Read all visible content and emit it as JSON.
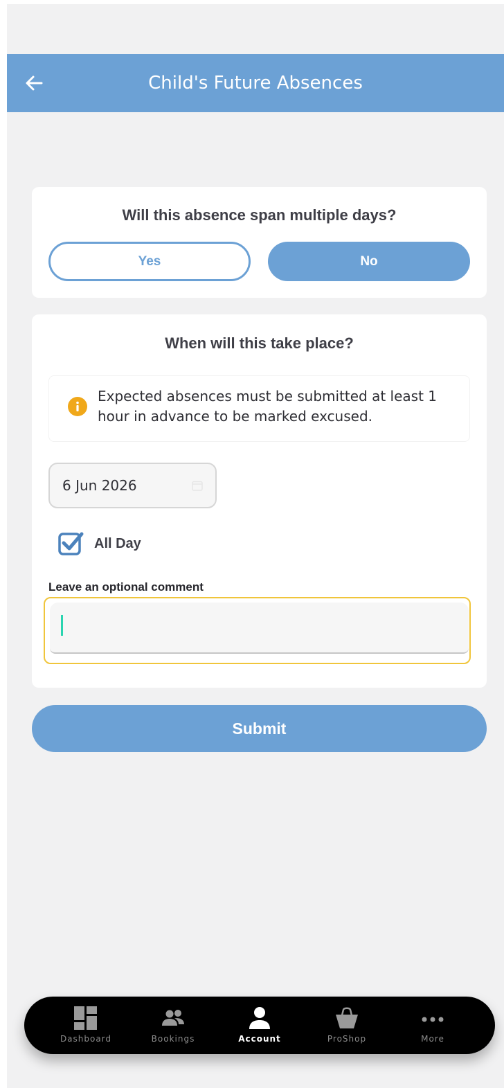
{
  "header": {
    "title": "Child's Future Absences",
    "back_icon": "arrow-left-icon"
  },
  "multi_day": {
    "question": "Will this absence span multiple days?",
    "yes_label": "Yes",
    "no_label": "No",
    "selected": "No"
  },
  "schedule": {
    "question": "When will this take place?",
    "notice_icon": "info-icon",
    "notice_text": "Expected absences must be submitted at least 1 hour in advance to be marked excused.",
    "date_value": "6 Jun 2026",
    "all_day_label": "All Day",
    "all_day_checked": true,
    "comment_label": "Leave an optional comment",
    "comment_value": ""
  },
  "submit_label": "Submit",
  "tabbar": {
    "items": [
      {
        "label": "Dashboard",
        "icon": "dashboard-icon",
        "active": false
      },
      {
        "label": "Bookings",
        "icon": "people-icon",
        "active": false
      },
      {
        "label": "Account",
        "icon": "person-icon",
        "active": true
      },
      {
        "label": "ProShop",
        "icon": "basket-icon",
        "active": false
      },
      {
        "label": "More",
        "icon": "more-icon",
        "active": false
      }
    ]
  },
  "colors": {
    "primary": "#6ca1d5",
    "background": "#f1f1f2",
    "notice_icon": "#f0a81a",
    "focus_outline": "#f0c53b",
    "caret": "#2ad4b0",
    "tabbar": "#000000"
  }
}
